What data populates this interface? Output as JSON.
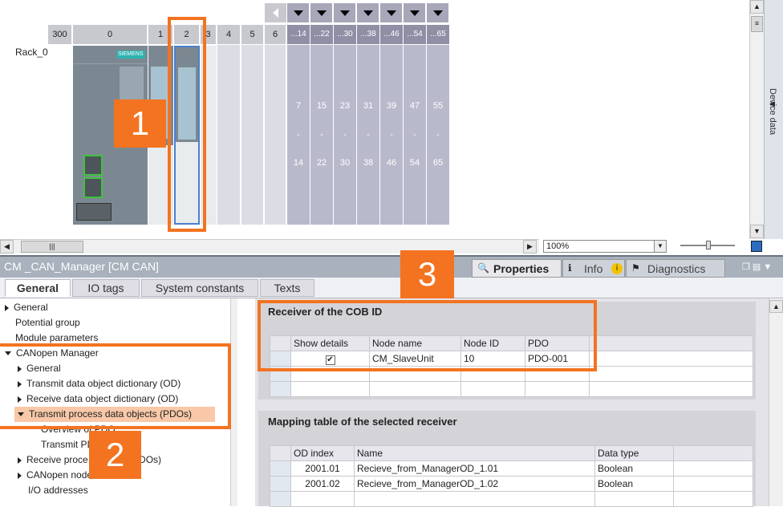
{
  "rack": {
    "label": "Rack_0",
    "slots": [
      "300",
      "0",
      "1",
      "2",
      "3",
      "4",
      "5",
      "6"
    ],
    "ext_headers": [
      "...14",
      "...22",
      "...30",
      "...38",
      "...46",
      "...54",
      "...65"
    ],
    "ext_top": [
      "7",
      "15",
      "23",
      "31",
      "39",
      "47",
      "55"
    ],
    "ext_dash": [
      "-",
      "-",
      "-",
      "-",
      "-",
      "-",
      "-"
    ],
    "ext_bottom": [
      "14",
      "22",
      "30",
      "38",
      "46",
      "54",
      "65"
    ],
    "brand": "SIEMENS",
    "side_tab": "Device data"
  },
  "zoom": {
    "value": "100%"
  },
  "callouts": {
    "one": "1",
    "two": "2",
    "three": "3"
  },
  "inspector": {
    "title": "CM _CAN_Manager [CM CAN]",
    "properties_tab": "Properties",
    "info_tab": "Info",
    "diagnostics_tab": "Diagnostics",
    "tabs": [
      "General",
      "IO tags",
      "System constants",
      "Texts"
    ]
  },
  "tree": {
    "general": "General",
    "potential": "Potential group",
    "module_params": "Module parameters",
    "canopen_manager": "CANopen Manager",
    "cm_general": "General",
    "tx_od": "Transmit data object dictionary (OD)",
    "rx_od": "Receive data object dictionary (OD)",
    "tx_pdo": "Transmit process data objects (PDOs)",
    "overview": "Overview of PDO ...",
    "transmit_pd": "Transmit PD...",
    "rx_pdo": "Receive proce... ...jects (PDOs)",
    "canopen_node": "CANopen node...",
    "io_addresses": "I/O addresses"
  },
  "receiver": {
    "title": "Receiver of the COB ID",
    "headers": [
      "Show details",
      "Node name",
      "Node ID",
      "PDO"
    ],
    "row": {
      "checked": "✔",
      "node_name": "CM_SlaveUnit",
      "node_id": "10",
      "pdo": "PDO-001"
    }
  },
  "mapping": {
    "title": "Mapping table of the selected receiver",
    "headers": [
      "OD index",
      "Name",
      "Data type"
    ],
    "rows": [
      {
        "od": "2001.01",
        "name": "Recieve_from_ManagerOD_1.01",
        "type": "Boolean"
      },
      {
        "od": "2001.02",
        "name": "Recieve_from_ManagerOD_1.02",
        "type": "Boolean"
      }
    ]
  }
}
